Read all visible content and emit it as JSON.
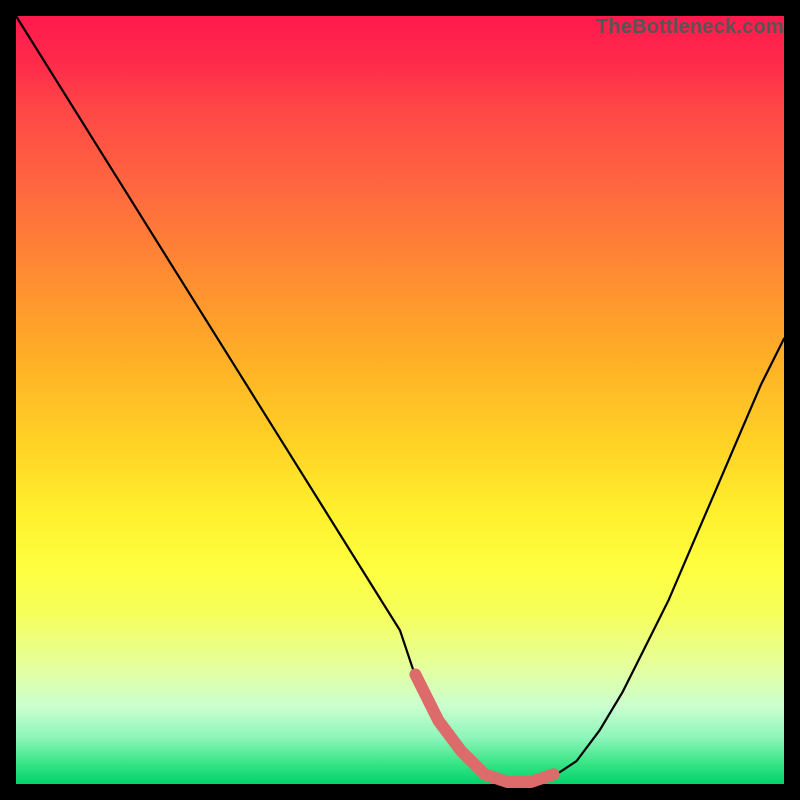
{
  "watermark": "TheBottleneck.com",
  "chart_data": {
    "type": "line",
    "title": "",
    "xlabel": "",
    "ylabel": "",
    "xlim": [
      0,
      100
    ],
    "ylim": [
      0,
      100
    ],
    "series": [
      {
        "name": "curve",
        "x": [
          0,
          5,
          10,
          15,
          20,
          25,
          30,
          35,
          40,
          45,
          50,
          52,
          55,
          58,
          61,
          64,
          67,
          70,
          73,
          76,
          79,
          82,
          85,
          88,
          91,
          94,
          97,
          100
        ],
        "y": [
          100,
          92,
          84,
          76,
          68,
          60,
          52,
          44,
          36,
          28,
          20,
          14,
          8,
          4,
          1,
          0,
          0,
          1,
          3,
          7,
          12,
          18,
          24,
          31,
          38,
          45,
          52,
          58
        ]
      },
      {
        "name": "highlight-band",
        "x": [
          52,
          72
        ],
        "y": [
          0,
          0
        ]
      }
    ],
    "colors": {
      "curve": "#000000",
      "highlight": "#dd6b6b"
    }
  }
}
